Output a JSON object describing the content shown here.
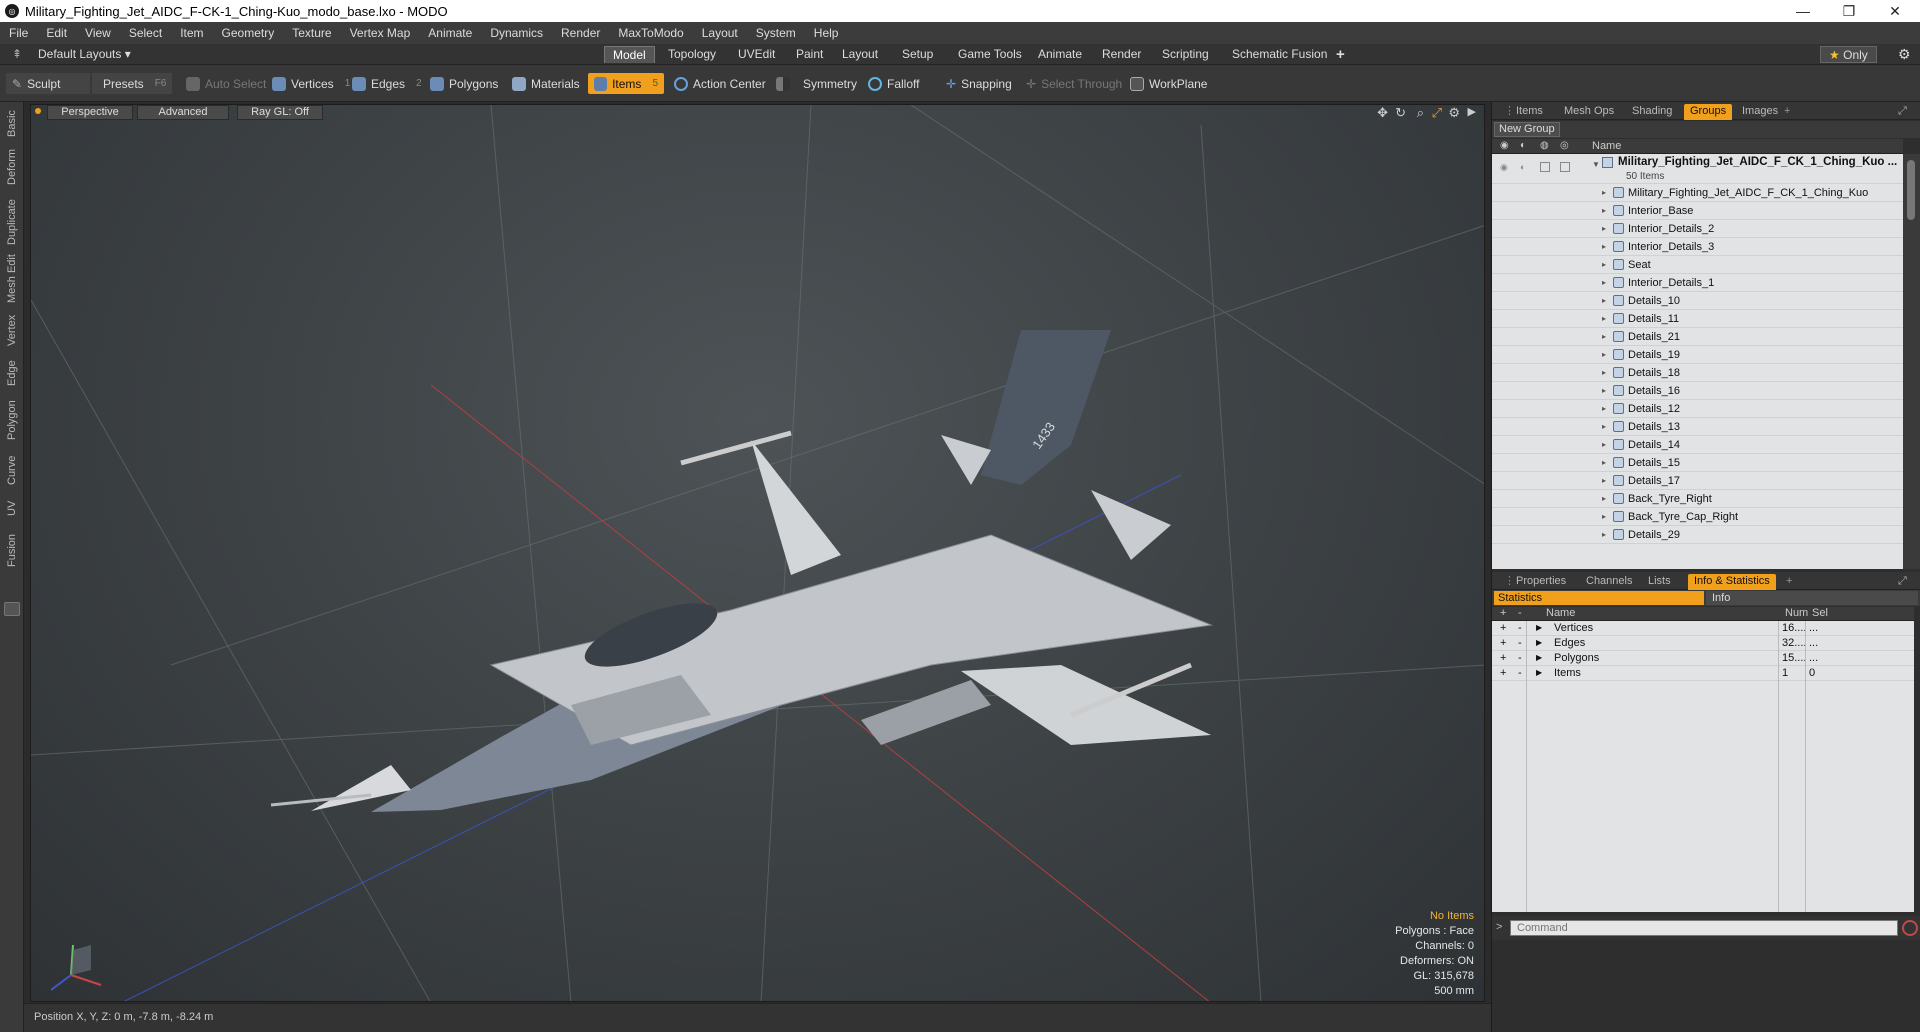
{
  "window": {
    "title": "Military_Fighting_Jet_AIDC_F-CK-1_Ching-Kuo_modo_base.lxo - MODO"
  },
  "menu": [
    "File",
    "Edit",
    "View",
    "Select",
    "Item",
    "Geometry",
    "Texture",
    "Vertex Map",
    "Animate",
    "Dynamics",
    "Render",
    "MaxToModo",
    "Layout",
    "System",
    "Help"
  ],
  "layouts": {
    "default": "Default Layouts ▾",
    "tabs": [
      "Model",
      "Topology",
      "UVEdit",
      "Paint",
      "Layout",
      "Setup",
      "Game Tools",
      "Animate",
      "Render",
      "Scripting",
      "Schematic Fusion"
    ],
    "add": "+",
    "only": "Only"
  },
  "toolbar": {
    "sculpt": "Sculpt",
    "presets": "Presets",
    "presets_key": "F6",
    "auto_select": "Auto Select",
    "vertices": "Vertices",
    "vertices_key": "1",
    "edges": "Edges",
    "edges_key": "2",
    "polygons": "Polygons",
    "materials": "Materials",
    "items": "Items",
    "items_key": "5",
    "action_center": "Action Center",
    "symmetry": "Symmetry",
    "falloff": "Falloff",
    "snapping": "Snapping",
    "select_through": "Select Through",
    "workplane": "WorkPlane"
  },
  "left_tabs": [
    "Basic",
    "Deform",
    "Duplicate",
    "Mesh Edit",
    "Vertex",
    "Edge",
    "Polygon",
    "Curve",
    "UV",
    "Fusion"
  ],
  "viewport": {
    "perspective": "Perspective",
    "advanced": "Advanced",
    "raygl": "Ray GL: Off",
    "stats": {
      "no_items": "No Items",
      "polygons": "Polygons : Face",
      "channels": "Channels: 0",
      "deformers": "Deformers: ON",
      "gl": "GL: 315,678",
      "scale": "500 mm"
    },
    "aircraft_number": "1433"
  },
  "status": {
    "position": "Position X, Y, Z:  0 m, -7.8 m, -8.24 m"
  },
  "top_panel": {
    "tabs": [
      "Items",
      "Mesh Ops",
      "Shading",
      "Groups",
      "Images"
    ],
    "active": "Groups",
    "new_group": "New Group",
    "col_name": "Name",
    "root": "Military_Fighting_Jet_AIDC_F_CK_1_Ching_Kuo ...",
    "root_count": "50 Items",
    "rows": [
      "Military_Fighting_Jet_AIDC_F_CK_1_Ching_Kuo",
      "Interior_Base",
      "Interior_Details_2",
      "Interior_Details_3",
      "Seat",
      "Interior_Details_1",
      "Details_10",
      "Details_11",
      "Details_21",
      "Details_19",
      "Details_18",
      "Details_16",
      "Details_12",
      "Details_13",
      "Details_14",
      "Details_15",
      "Details_17",
      "Back_Tyre_Right",
      "Back_Tyre_Cap_Right",
      "Details_29"
    ]
  },
  "bottom_panel": {
    "tabs": [
      "Properties",
      "Channels",
      "Lists",
      "Info & Statistics"
    ],
    "active": "Info & Statistics",
    "sub_statistics": "Statistics",
    "sub_info": "Info",
    "col_name": "Name",
    "col_num": "Num",
    "col_sel": "Sel",
    "rows": [
      {
        "name": "Vertices",
        "num": "16....",
        "sel": "..."
      },
      {
        "name": "Edges",
        "num": "32....",
        "sel": "..."
      },
      {
        "name": "Polygons",
        "num": "15....",
        "sel": "..."
      },
      {
        "name": "Items",
        "num": "1",
        "sel": "0"
      }
    ],
    "command_placeholder": "Command"
  },
  "colors": {
    "accent": "#f1a01d",
    "panel_bg": "#2e2e2e",
    "tree_bg": "#e1e3e5"
  }
}
